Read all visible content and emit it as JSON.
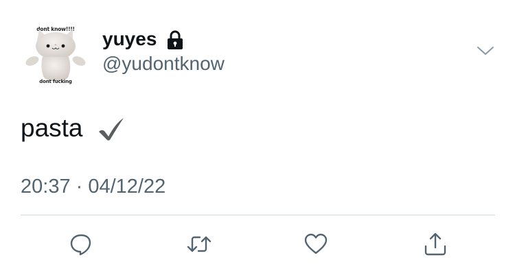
{
  "author": {
    "display_name": "yuyes",
    "username": "@yudontknow",
    "avatar_text_top": "dont know!!!!",
    "avatar_text_bottom": "dont fucking"
  },
  "tweet": {
    "text": "pasta",
    "timestamp": "20:37 · 04/12/22"
  },
  "icons": {
    "protected": "lock-icon",
    "menu": "chevron-down-icon",
    "emoji": "check-mark-icon",
    "actions": [
      "reply-icon",
      "retweet-icon",
      "like-icon",
      "share-icon"
    ]
  },
  "colors": {
    "text": "#0f1419",
    "secondary": "#536471",
    "divider": "#cfd9de"
  }
}
